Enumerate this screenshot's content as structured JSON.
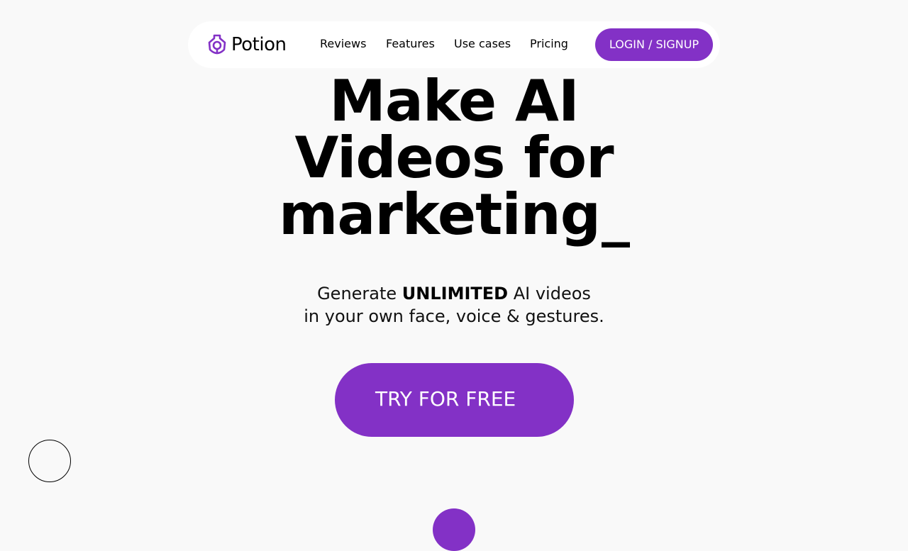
{
  "nav": {
    "logo_text": "Potion",
    "logo_icon": "potion-logo-icon",
    "links": [
      "Reviews",
      "Features",
      "Use cases",
      "Pricing"
    ],
    "login_label": "LOGIN / SIGNUP"
  },
  "hero": {
    "title_lines": [
      "Make AI",
      "Videos for",
      "marketing"
    ],
    "cursor": "_",
    "subtitle_pre": "Generate ",
    "subtitle_bold": "UNLIMITED",
    "subtitle_post": " AI videos",
    "subtitle_line2": "in your own face, voice & gestures.",
    "cta_label": "TRY FOR FREE"
  },
  "colors": {
    "accent": "#8331c6",
    "background": "#f9f9f9",
    "nav_background": "#ffffff"
  }
}
